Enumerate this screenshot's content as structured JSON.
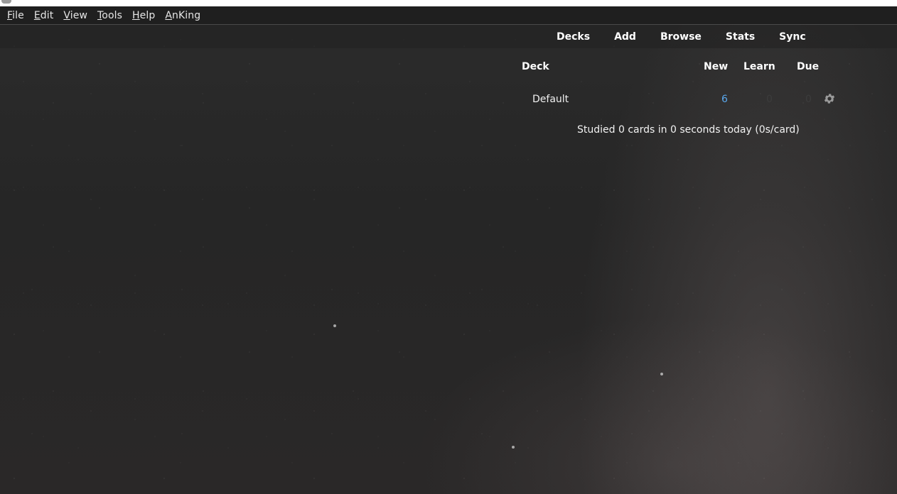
{
  "menubar": {
    "items": [
      {
        "label": "File",
        "mnemonic": "F",
        "rest": "ile"
      },
      {
        "label": "Edit",
        "mnemonic": "E",
        "rest": "dit"
      },
      {
        "label": "View",
        "mnemonic": "V",
        "rest": "iew"
      },
      {
        "label": "Tools",
        "mnemonic": "T",
        "rest": "ools"
      },
      {
        "label": "Help",
        "mnemonic": "H",
        "rest": "elp"
      },
      {
        "label": "AnKing",
        "mnemonic": "A",
        "rest": "nKing"
      }
    ]
  },
  "toolbar": {
    "decks": "Decks",
    "add": "Add",
    "browse": "Browse",
    "stats": "Stats",
    "sync": "Sync"
  },
  "deck_table": {
    "headers": {
      "deck": "Deck",
      "new": "New",
      "learn": "Learn",
      "due": "Due"
    },
    "rows": [
      {
        "name": "Default",
        "new": "6",
        "learn": "0",
        "due": "0"
      }
    ]
  },
  "studied_text": "Studied 0 cards in 0 seconds today (0s/card)",
  "colors": {
    "menubar_bg": "#1f1f1f",
    "new_count": "#5aa9ef",
    "text": "#ffffff"
  },
  "icons": {
    "deck_options": "gear-icon"
  }
}
